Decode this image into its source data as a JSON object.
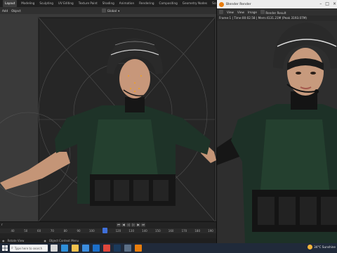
{
  "blender": {
    "workspace_tabs": [
      "Layout",
      "Modeling",
      "Sculpting",
      "UV Editing",
      "Texture Paint",
      "Shading",
      "Animation",
      "Rendering",
      "Compositing",
      "Geometry Nodes",
      "Scripting"
    ],
    "active_tab": "Layout",
    "viewport_menu": [
      "Add",
      "Object"
    ],
    "transform_orientation": "Global",
    "timeline": {
      "frame_label": "r",
      "ticks": [
        "40",
        "50",
        "60",
        "70",
        "80",
        "90",
        "100",
        "110",
        "120",
        "130",
        "140",
        "150",
        "160",
        "170",
        "180",
        "190"
      ],
      "current_frame": "110"
    },
    "status_bar": {
      "left": "Rotate View",
      "right": "Object Context Menu"
    }
  },
  "render_window": {
    "title": "Blender Render",
    "menu": [
      "View",
      "View",
      "Image",
      "Render Result"
    ],
    "info": "Frame:1 | Time:00:02.58 | Mem:4131.21M (Peak 3193.07M)"
  },
  "taskbar": {
    "search_placeholder": "Type here to search",
    "weather": "34°C  Sunshine",
    "apps": [
      {
        "icon": "task-view-icon",
        "color": "#d9d9d9"
      },
      {
        "icon": "edge-browser-icon",
        "color": "#2f8fd9"
      },
      {
        "icon": "file-explorer-icon",
        "color": "#f2c14e"
      },
      {
        "icon": "store-icon",
        "color": "#3c8dde"
      },
      {
        "icon": "mail-icon",
        "color": "#1c6fc9"
      },
      {
        "icon": "chrome-icon",
        "color": "#e0473c"
      },
      {
        "icon": "photoshop-icon",
        "color": "#1b3a5c"
      },
      {
        "icon": "image-viewer-icon",
        "color": "#5b6f86"
      },
      {
        "icon": "blender-icon",
        "color": "#e87d0d"
      }
    ]
  }
}
